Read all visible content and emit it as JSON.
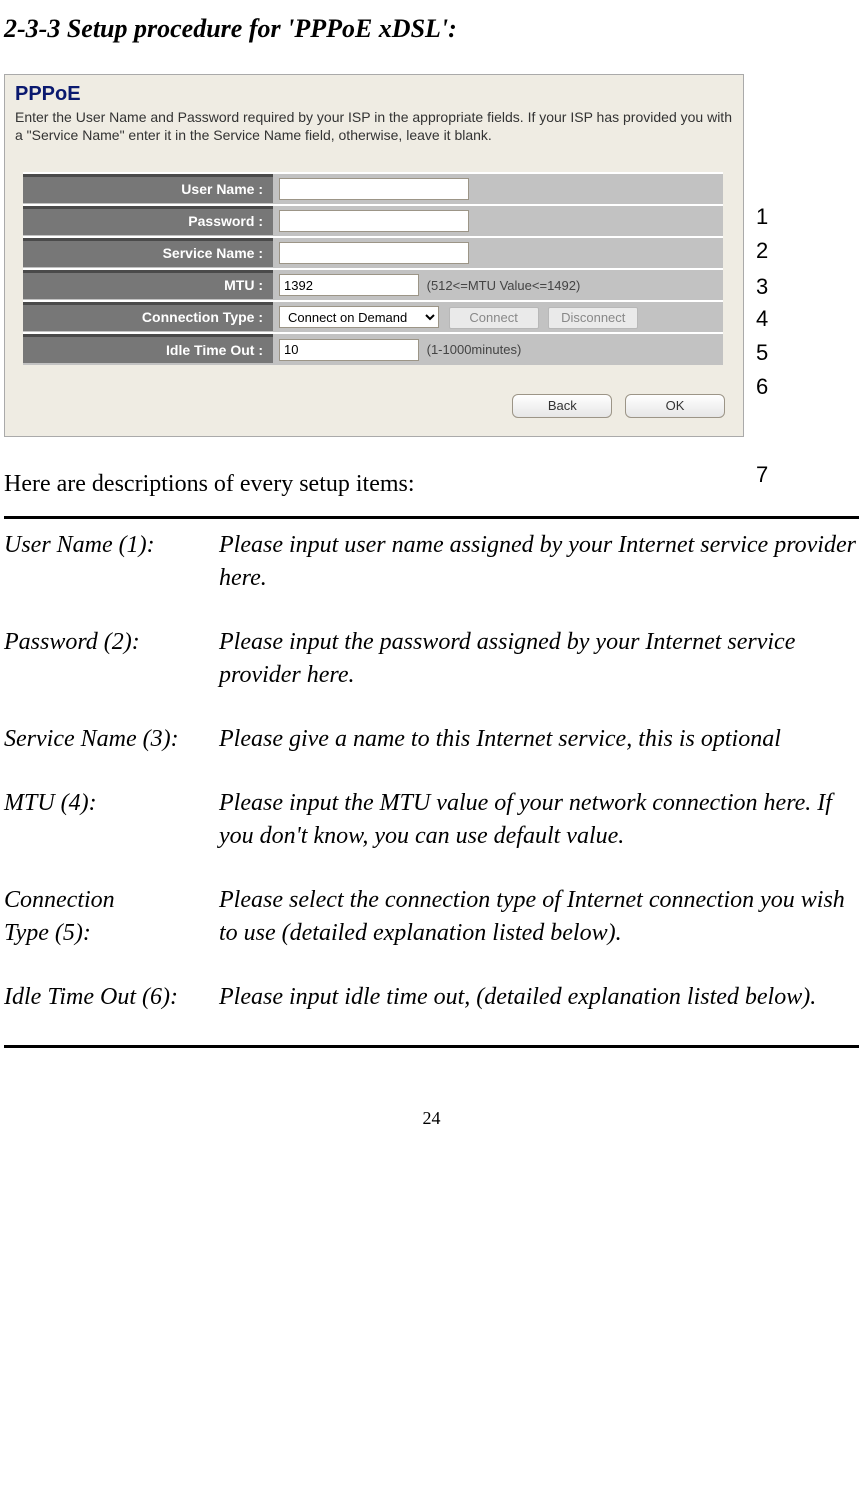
{
  "section_title": "2-3-3 Setup procedure for 'PPPoE xDSL':",
  "panel": {
    "title": "PPPoE",
    "subtitle": "Enter the User Name and Password required by your ISP in the appropriate fields. If your ISP has provided you with a \"Service Name\" enter it in the Service Name field, otherwise, leave it blank."
  },
  "fields": {
    "user_name": {
      "label": "User Name :",
      "value": ""
    },
    "password": {
      "label": "Password :",
      "value": ""
    },
    "service_name": {
      "label": "Service Name :",
      "value": ""
    },
    "mtu": {
      "label": "MTU :",
      "value": "1392",
      "hint": "(512<=MTU Value<=1492)"
    },
    "connection_type": {
      "label": "Connection Type :",
      "value": "Connect on Demand",
      "connect_label": "Connect",
      "disconnect_label": "Disconnect"
    },
    "idle_timeout": {
      "label": "Idle Time Out :",
      "value": "10",
      "hint": "(1-1000minutes)"
    }
  },
  "buttons": {
    "back": "Back",
    "ok": "OK"
  },
  "annotations": {
    "a1": "1",
    "a2": "2",
    "a3": "3",
    "a4": "4",
    "a5": "5",
    "a6": "6",
    "a7": "7"
  },
  "intro": "Here are descriptions of every setup items:",
  "descriptions": [
    {
      "term": "User Name (1):",
      "text": "Please input user name assigned by your Internet service provider here."
    },
    {
      "term": "Password (2):",
      "text": "Please input the password assigned by your Internet service provider here."
    },
    {
      "term": "Service Name (3):",
      "text": "Please give a name to this Internet service, this is optional"
    },
    {
      "term": "MTU (4):",
      "text": "Please input the MTU value of your network connection here. If you don't know, you can use default value."
    },
    {
      "term": "Connection\nType (5):",
      "text": "Please select the connection type of Internet connection you wish to use (detailed explanation listed below)."
    },
    {
      "term": "Idle Time Out (6):",
      "text": "Please input idle time out, (detailed explanation listed below)."
    }
  ],
  "page_number": "24"
}
